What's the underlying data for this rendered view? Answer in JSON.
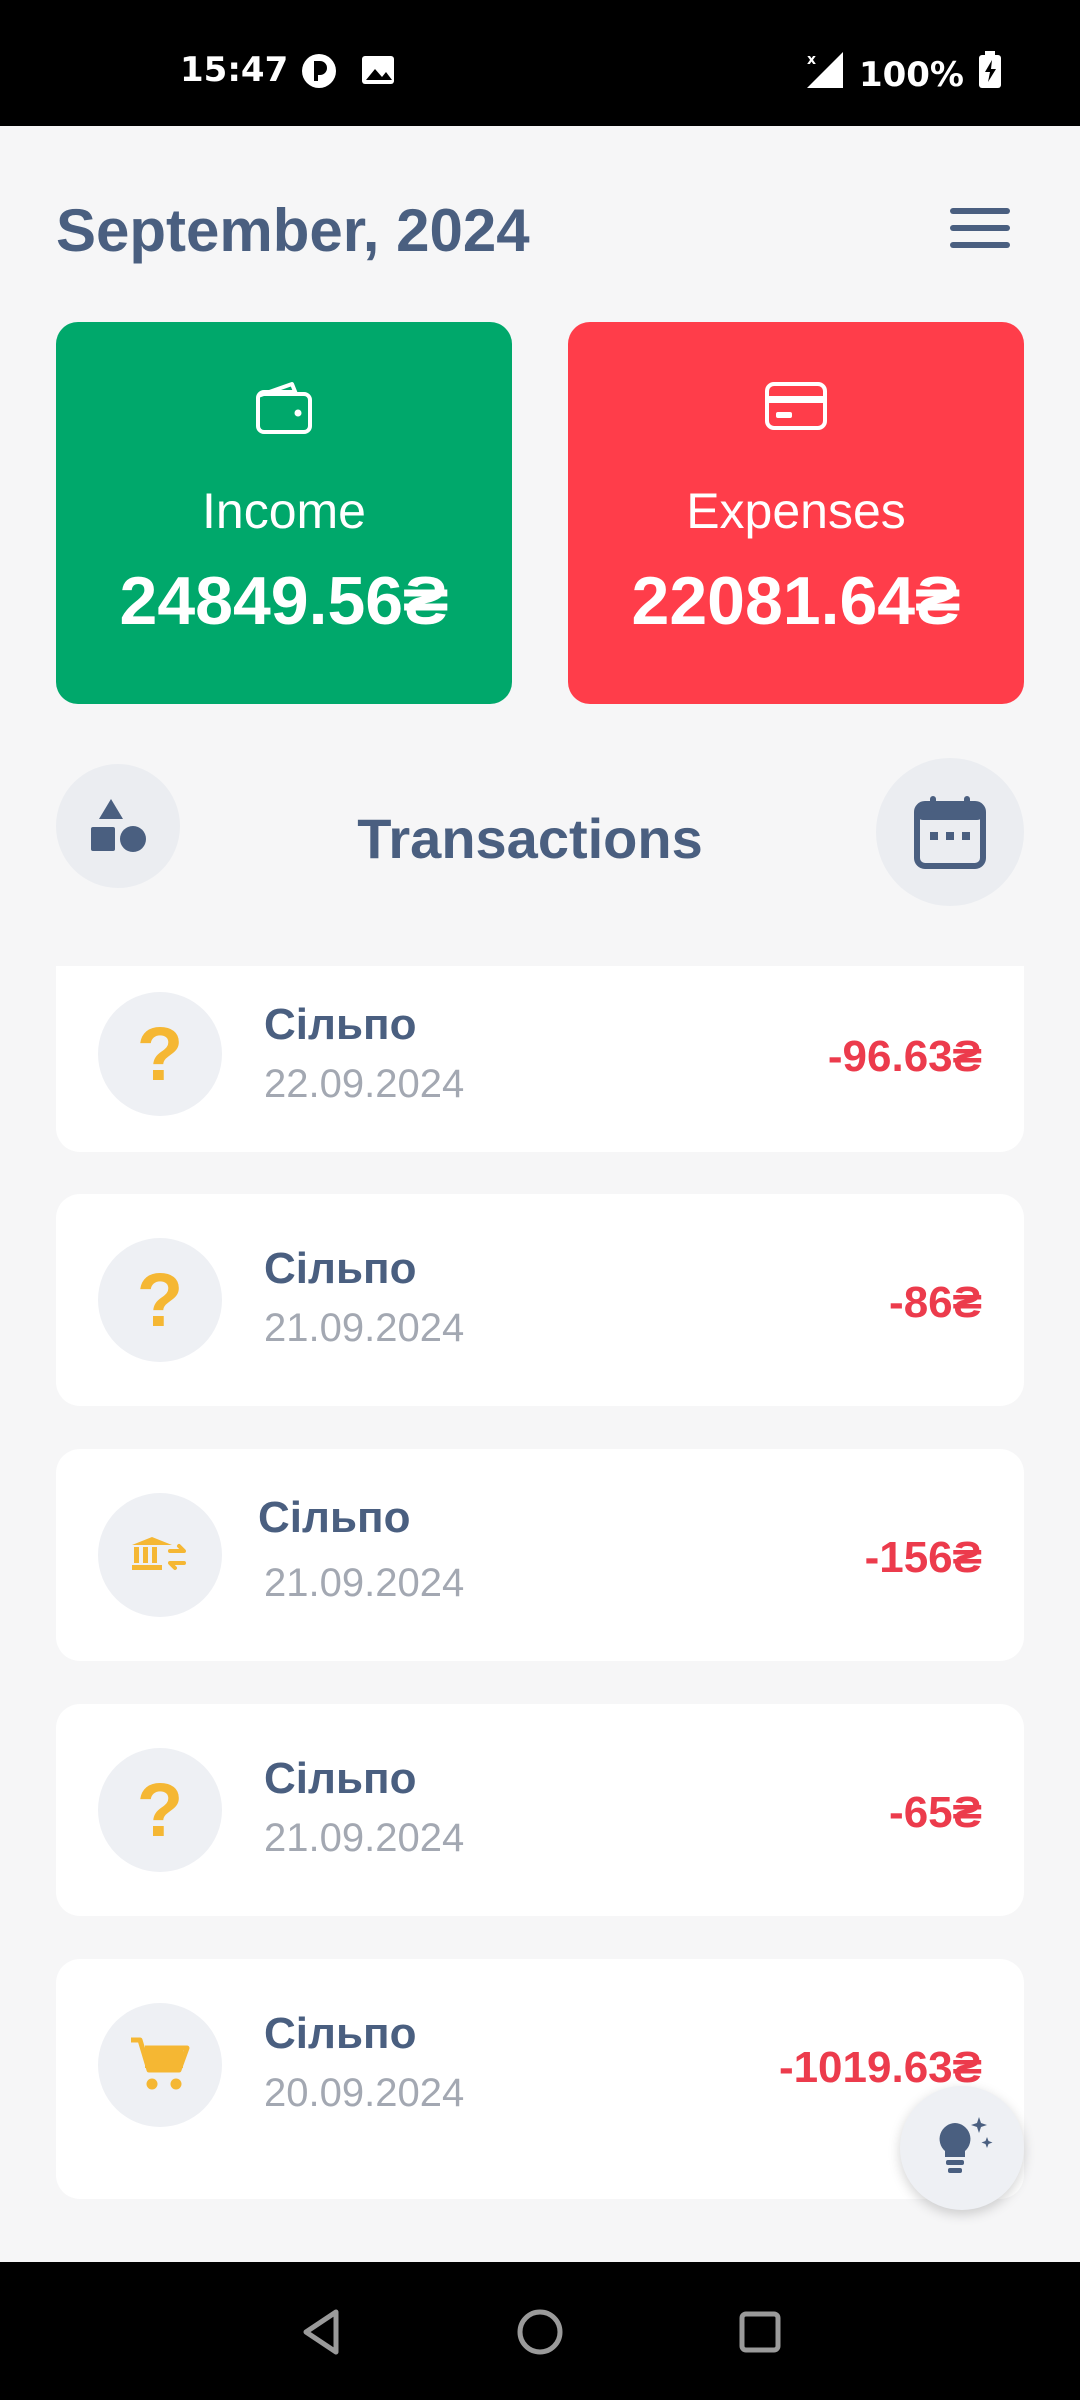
{
  "status_bar": {
    "time": "15:47",
    "battery": "100%",
    "icons": [
      "notification-icon",
      "gallery-icon",
      "signal-icon",
      "battery-charging-icon"
    ]
  },
  "header": {
    "title": "September, 2024",
    "menu_icon": "hamburger-menu-icon"
  },
  "summary": {
    "income": {
      "label": "Income",
      "value": "24849.56₴",
      "icon": "wallet-icon",
      "color": "#00a86b"
    },
    "expenses": {
      "label": "Expenses",
      "value": "22081.64₴",
      "icon": "credit-card-icon",
      "color": "#ff3d4a"
    }
  },
  "transactions": {
    "title": "Transactions",
    "left_button_icon": "categories-shapes-icon",
    "right_button_icon": "calendar-icon",
    "items": [
      {
        "name": "Сільпо",
        "date": "22.09.2024",
        "amount": "-96.63₴",
        "icon": "question-icon"
      },
      {
        "name": "Сільпо",
        "date": "21.09.2024",
        "amount": "-86₴",
        "icon": "question-icon"
      },
      {
        "name": "Сільпо",
        "date": "21.09.2024",
        "amount": "-156₴",
        "icon": "bank-transfer-icon"
      },
      {
        "name": "Сільпо",
        "date": "21.09.2024",
        "amount": "-65₴",
        "icon": "question-icon"
      },
      {
        "name": "Сільпо",
        "date": "20.09.2024",
        "amount": "-1019.63₴",
        "icon": "shopping-cart-icon"
      }
    ]
  },
  "fab": {
    "icon": "lightbulb-sparkle-icon"
  },
  "colors": {
    "accent_text": "#4a5f80",
    "negative": "#ec3b4c",
    "icon_yellow": "#f5b733"
  }
}
